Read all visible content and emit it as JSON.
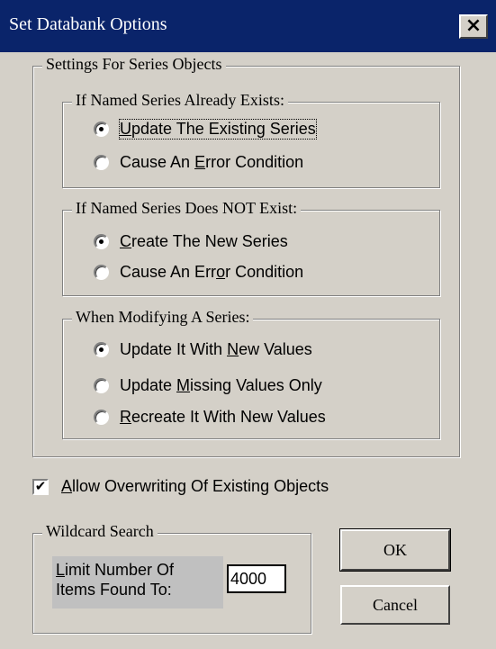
{
  "window": {
    "title": "Set Databank Options",
    "close_glyph": "×"
  },
  "series_group": {
    "legend": "Settings For Series Objects",
    "exists": {
      "legend": "If Named Series Already Exists:",
      "options": [
        {
          "pre": "",
          "key": "U",
          "post": "pdate The Existing Series",
          "checked": true
        },
        {
          "pre": "Cause An ",
          "key": "E",
          "post": "rror Condition",
          "checked": false
        }
      ]
    },
    "not_exists": {
      "legend": "If Named Series Does NOT Exist:",
      "options": [
        {
          "pre": "",
          "key": "C",
          "post": "reate The New Series",
          "checked": true
        },
        {
          "pre": "Cause An Err",
          "key": "o",
          "post": "r Condition",
          "checked": false
        }
      ]
    },
    "modifying": {
      "legend": "When Modifying A Series:",
      "options": [
        {
          "pre": "Update It With ",
          "key": "N",
          "post": "ew Values",
          "checked": true
        },
        {
          "pre": "Update ",
          "key": "M",
          "post": "issing Values Only",
          "checked": false
        },
        {
          "pre": "",
          "key": "R",
          "post": "ecreate It With New Values",
          "checked": false
        }
      ]
    }
  },
  "overwrite": {
    "pre": "",
    "key": "A",
    "post": "llow Overwriting Of Existing Objects",
    "checked": true,
    "mark": "✔"
  },
  "wildcard": {
    "legend": "Wildcard Search",
    "label_line1": "Limit Number Of",
    "label_line2": "Items Found To:",
    "value": "4000"
  },
  "buttons": {
    "ok": "OK",
    "cancel": "Cancel"
  }
}
